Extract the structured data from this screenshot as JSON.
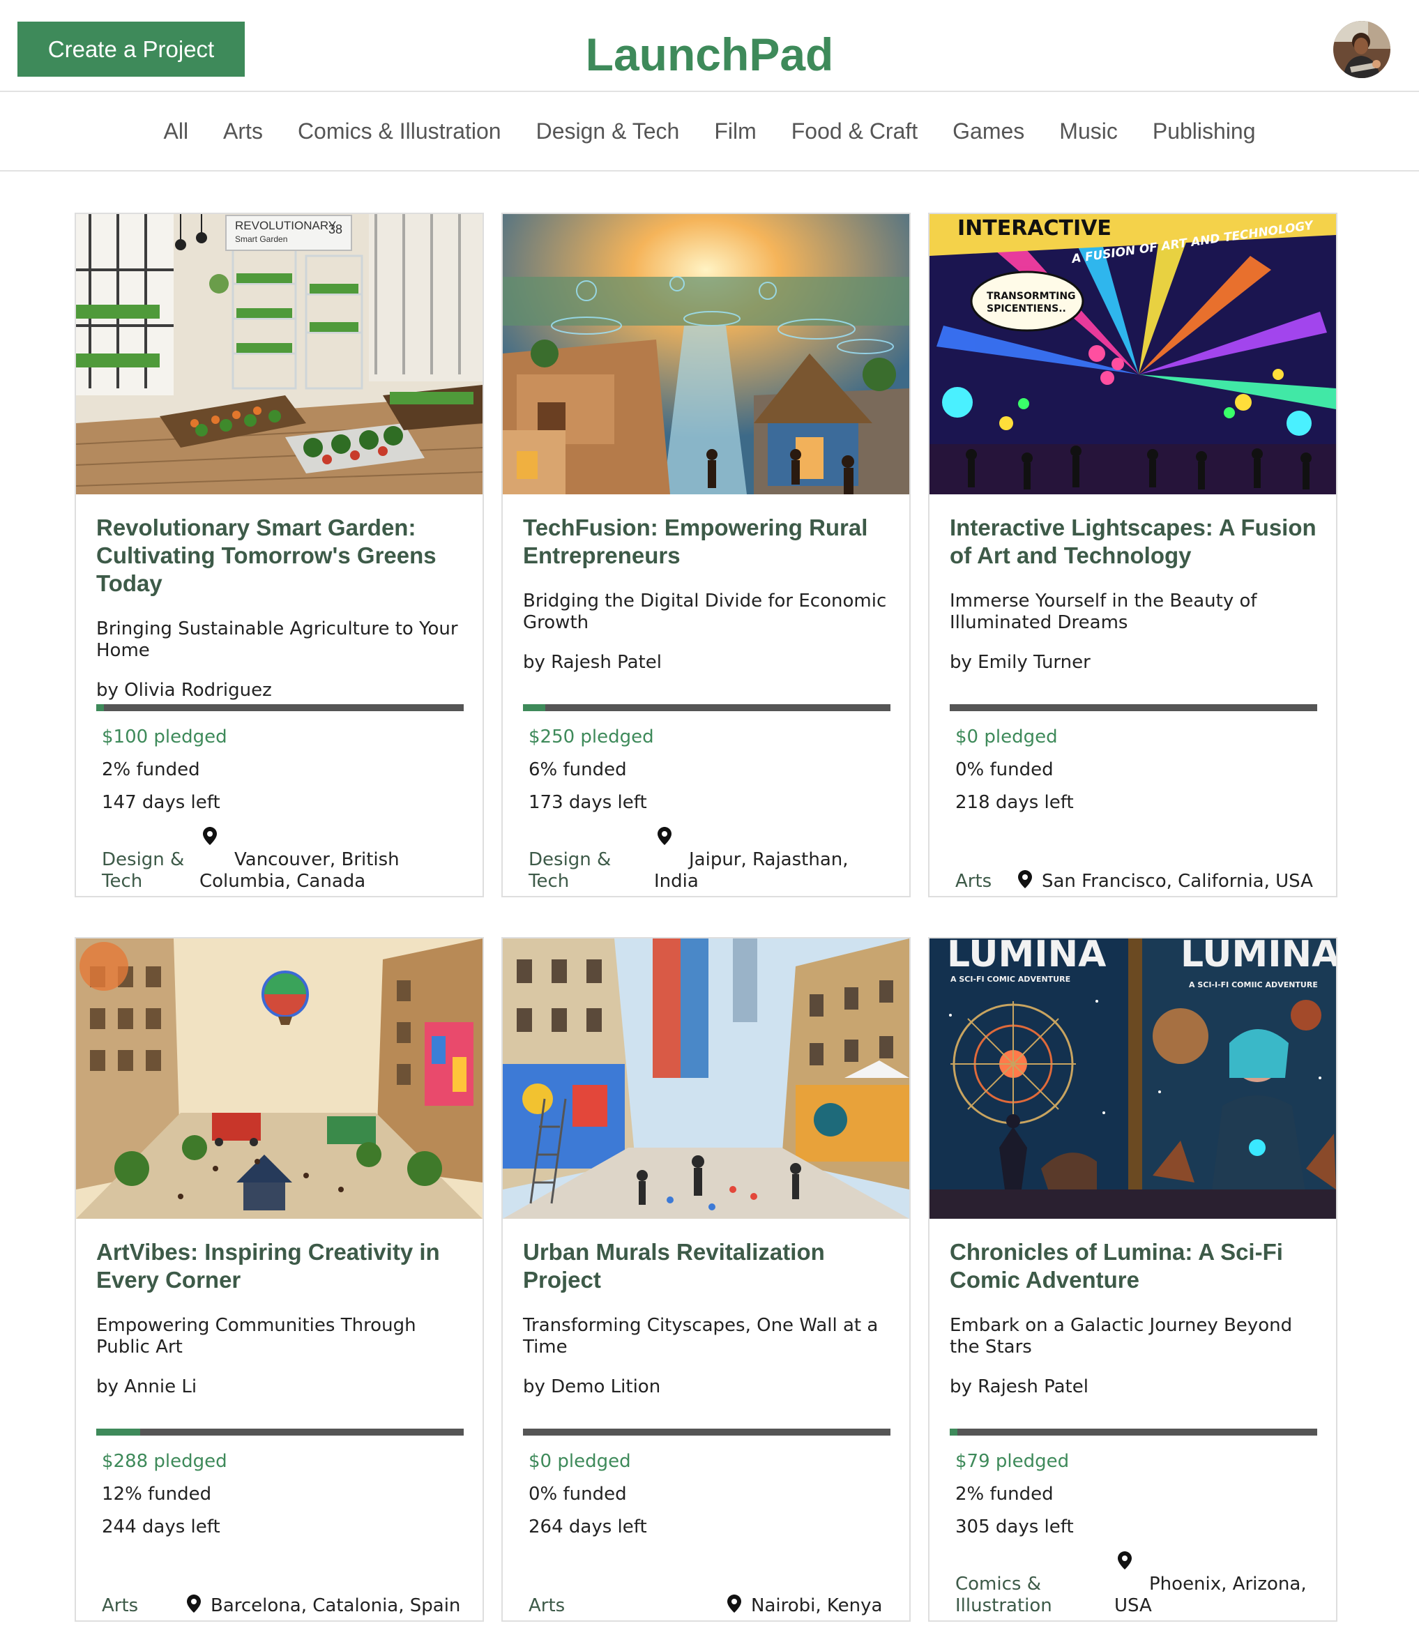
{
  "header": {
    "create_label": "Create a Project",
    "logo": "LaunchPad",
    "avatar_icon": "user-avatar"
  },
  "nav": [
    "All",
    "Arts",
    "Comics & Illustration",
    "Design & Tech",
    "Film",
    "Food & Craft",
    "Games",
    "Music",
    "Publishing"
  ],
  "colors": {
    "brand": "#3e8a5a",
    "title": "#3d5a48",
    "track": "#555555"
  },
  "cards": [
    {
      "image_icon": "smart-garden-image",
      "title": "Revolutionary Smart Garden: Cultivating Tomorrow's Greens Today",
      "subtitle": "Bringing Sustainable Agriculture to Your Home",
      "author": "by Olivia Rodriguez",
      "funded_fraction": 0.02,
      "pledged": "$100 pledged",
      "funded": "2% funded",
      "days_left": "147 days left",
      "category": "Design & Tech",
      "location": "Vancouver, British Columbia, Canada"
    },
    {
      "image_icon": "rural-tech-image",
      "title": "TechFusion: Empowering Rural Entrepreneurs",
      "subtitle": "Bridging the Digital Divide for Economic Growth",
      "author": "by Rajesh Patel",
      "funded_fraction": 0.06,
      "pledged": "$250 pledged",
      "funded": "6% funded",
      "days_left": "173 days left",
      "category": "Design & Tech",
      "location": "Jaipur, Rajasthan, India"
    },
    {
      "image_icon": "lightscapes-image",
      "title": "Interactive Lightscapes: A Fusion of Art and Technology",
      "subtitle": "Immerse Yourself in the Beauty of Illuminated Dreams",
      "author": "by Emily Turner",
      "funded_fraction": 0.0,
      "pledged": "$0 pledged",
      "funded": "0% funded",
      "days_left": "218 days left",
      "category": "Arts",
      "location": "San Francisco, California, USA"
    },
    {
      "image_icon": "city-art-image",
      "title": "ArtVibes: Inspiring Creativity in Every Corner",
      "subtitle": "Empowering Communities Through Public Art",
      "author": "by Annie Li",
      "funded_fraction": 0.12,
      "pledged": "$288 pledged",
      "funded": "12% funded",
      "days_left": "244 days left",
      "category": "Arts",
      "location": "Barcelona, Catalonia, Spain"
    },
    {
      "image_icon": "urban-murals-image",
      "title": "Urban Murals Revitalization Project",
      "subtitle": "Transforming Cityscapes, One Wall at a Time",
      "author": "by Demo Lition",
      "funded_fraction": 0.0,
      "pledged": "$0 pledged",
      "funded": "0% funded",
      "days_left": "264 days left",
      "category": "Arts",
      "location": "Nairobi, Kenya"
    },
    {
      "image_icon": "scifi-comic-image",
      "title": "Chronicles of Lumina: A Sci-Fi Comic Adventure",
      "subtitle": "Embark on a Galactic Journey Beyond the Stars",
      "author": "by Rajesh Patel",
      "funded_fraction": 0.02,
      "pledged": "$79 pledged",
      "funded": "2% funded",
      "days_left": "305 days left",
      "category": "Comics & Illustration",
      "location": "Phoenix, Arizona, USA"
    }
  ],
  "image_text": {
    "garden_sign": "REVOLUTIONARY",
    "garden_sign_small": "Smart Garden",
    "garden_sign_num": "38",
    "lights_banner_top": "INTERACTIVE",
    "lights_banner": "A FUSION OF ART AND TECHNOLOGY",
    "lights_bubble_1": "TRANSORMTING",
    "lights_bubble_2": "SPICENTIENS..",
    "comic_title_left": "LUMINA",
    "comic_sub_left": "A SCI-FI COMIC ADVENTURE",
    "comic_title_right": "LUMINA",
    "comic_sub_right": "A SCI-I-FI COMIIC ADVENTURE"
  }
}
